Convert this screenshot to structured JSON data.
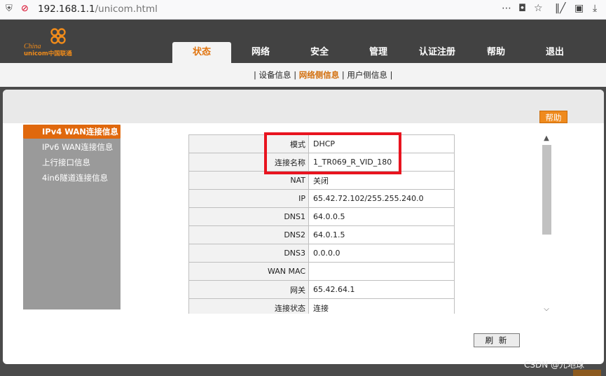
{
  "browser": {
    "url_host": "192.168.1.1",
    "url_path": "/unicom.html",
    "more_icon": "ellipsis-icon",
    "pocket_icon": "pocket-icon",
    "star_icon": "star-icon",
    "library_icon": "library-icon",
    "sidebar_icon": "sidebar-icon",
    "download_icon": "download-icon"
  },
  "logo": {
    "text_en1": "China",
    "text_en2": "unicom中国联通"
  },
  "nav": {
    "items": [
      "状态",
      "网络",
      "安全",
      "管理",
      "认证注册",
      "帮助",
      "退出"
    ],
    "active_index": 0,
    "accent": "#e1740e"
  },
  "subnav": {
    "sep": "|",
    "items": [
      "设备信息",
      "网络侧信息",
      "用户侧信息"
    ],
    "active_index": 1
  },
  "help_button": "帮助",
  "sidemenu": {
    "items": [
      "IPv4 WAN连接信息",
      "IPv6 WAN连接信息",
      "上行接口信息",
      "4in6隧道连接信息"
    ],
    "active_index": 0
  },
  "wan_table": {
    "rows": [
      {
        "key": "模式",
        "value": "DHCP"
      },
      {
        "key": "连接名称",
        "value": "1_TR069_R_VID_180"
      },
      {
        "key": "NAT",
        "value": "关闭"
      },
      {
        "key": "IP",
        "value": "65.42.72.102/255.255.240.0"
      },
      {
        "key": "DNS1",
        "value": "64.0.0.5"
      },
      {
        "key": "DNS2",
        "value": "64.0.1.5"
      },
      {
        "key": "DNS3",
        "value": "0.0.0.0"
      },
      {
        "key": "WAN MAC",
        "value": ""
      },
      {
        "key": "网关",
        "value": "65.42.64.1"
      },
      {
        "key": "连接状态",
        "value": "连接"
      }
    ]
  },
  "refresh_button": "刷 新",
  "watermark": "CSDN @元地球"
}
